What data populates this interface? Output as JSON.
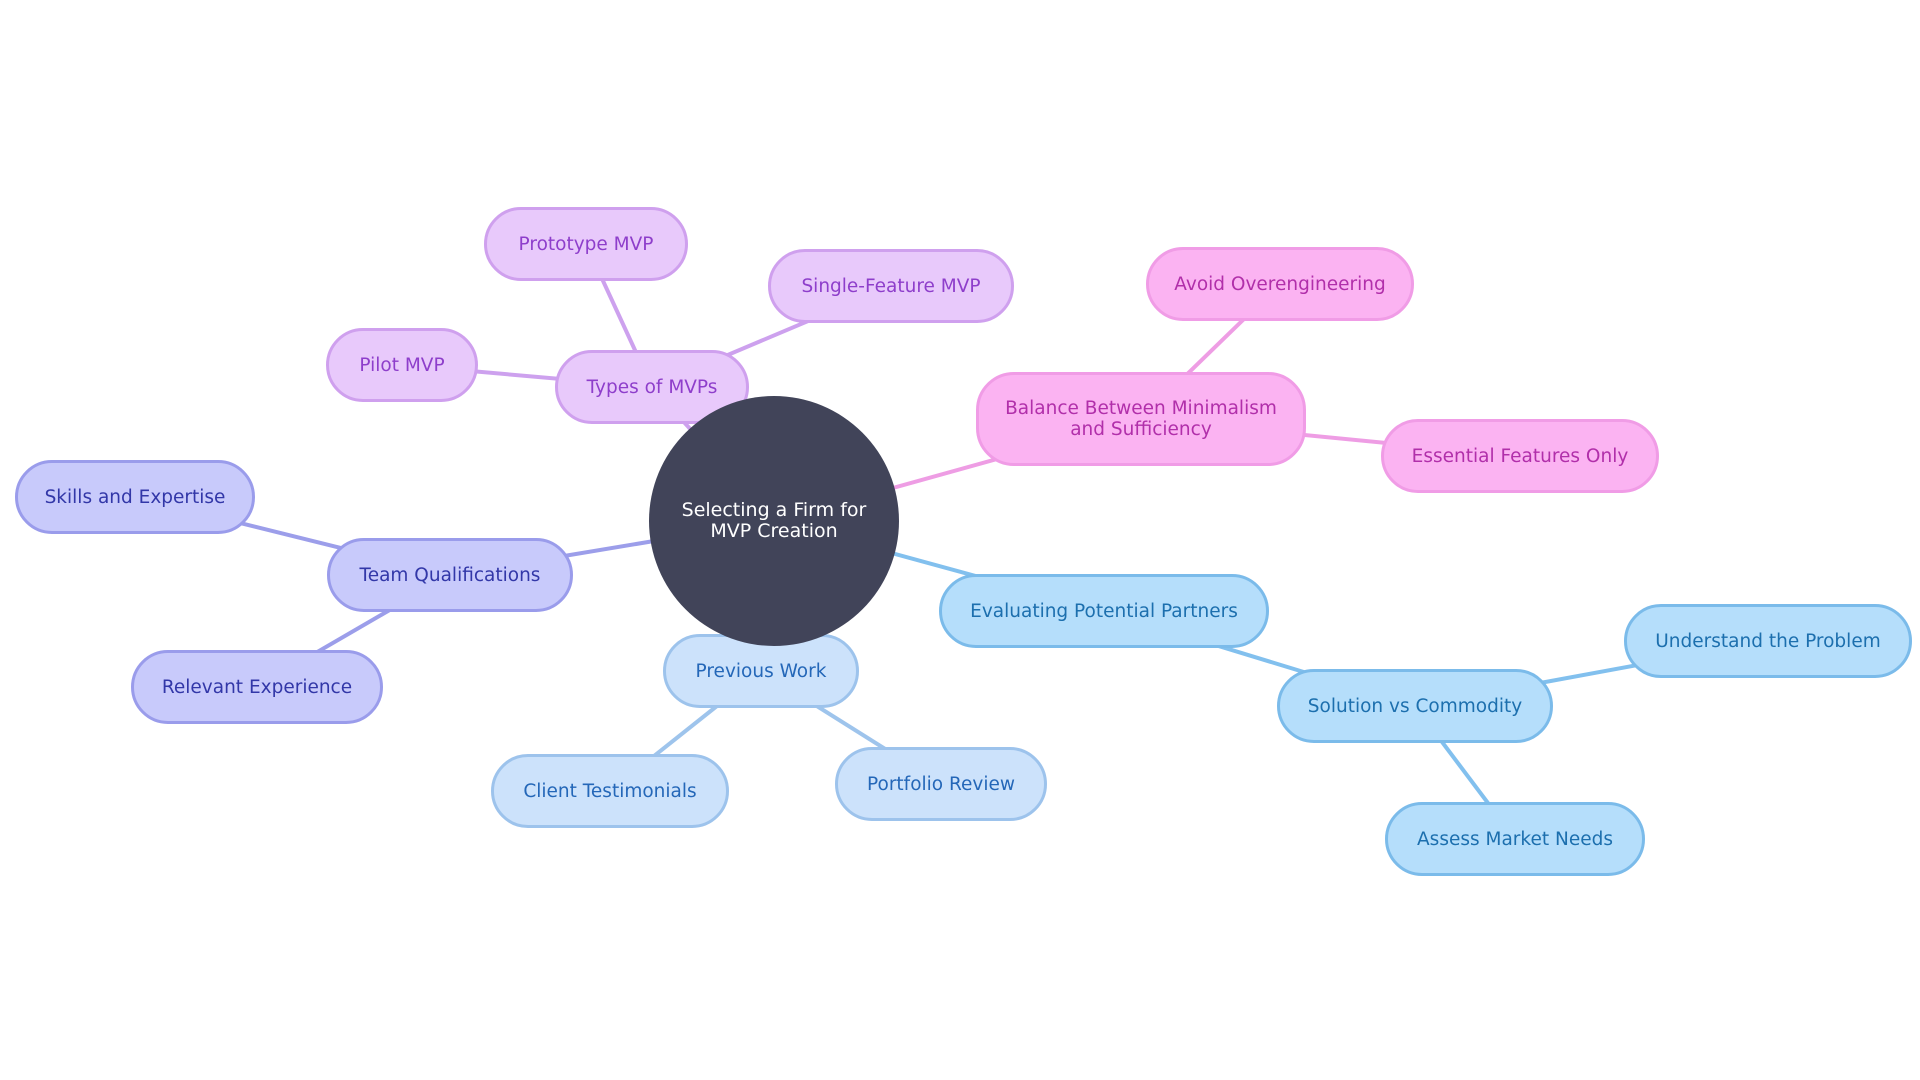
{
  "title": "Selecting a Firm for MVP Creation",
  "theme": {
    "root_fill": "#414459",
    "root_text": "#ffffff",
    "branches": {
      "purple": {
        "fill": "#E8C9FB",
        "border": "#CFA0EE",
        "text": "#8E3ECB",
        "line": "#CDA1EE"
      },
      "pink": {
        "fill": "#FBB3F2",
        "border": "#F09CE6",
        "text": "#B12FAA",
        "line": "#EE9DE4"
      },
      "cyan": {
        "fill": "#B5DEFB",
        "border": "#7BBBEA",
        "text": "#1C6FAE",
        "line": "#82C0EE"
      },
      "lightblue": {
        "fill": "#CCE2FB",
        "border": "#9DC3EC",
        "text": "#2467B8",
        "line": "#9EC4EC"
      },
      "indigo": {
        "fill": "#C8CAFB",
        "border": "#9A9CEB",
        "text": "#3237A8",
        "line": "#9C9EEA"
      }
    }
  },
  "nodes": [
    {
      "id": "root",
      "label": "Selecting a Firm for MVP Creation",
      "branch": "root",
      "parent": null
    },
    {
      "id": "types",
      "label": "Types of MVPs",
      "branch": "purple",
      "parent": "root"
    },
    {
      "id": "prototype",
      "label": "Prototype MVP",
      "branch": "purple",
      "parent": "types"
    },
    {
      "id": "single",
      "label": "Single-Feature MVP",
      "branch": "purple",
      "parent": "types"
    },
    {
      "id": "pilot",
      "label": "Pilot MVP",
      "branch": "purple",
      "parent": "types"
    },
    {
      "id": "balance",
      "label": "Balance Between Minimalism and Sufficiency",
      "branch": "pink",
      "parent": "root"
    },
    {
      "id": "avoid",
      "label": "Avoid Overengineering",
      "branch": "pink",
      "parent": "balance"
    },
    {
      "id": "essential",
      "label": "Essential Features Only",
      "branch": "pink",
      "parent": "balance"
    },
    {
      "id": "evaluating",
      "label": "Evaluating Potential Partners",
      "branch": "cyan",
      "parent": "root"
    },
    {
      "id": "solution",
      "label": "Solution vs Commodity",
      "branch": "cyan",
      "parent": "evaluating"
    },
    {
      "id": "understand",
      "label": "Understand the Problem",
      "branch": "cyan",
      "parent": "solution"
    },
    {
      "id": "assess",
      "label": "Assess Market Needs",
      "branch": "cyan",
      "parent": "solution"
    },
    {
      "id": "previous",
      "label": "Previous Work",
      "branch": "lightblue",
      "parent": "root"
    },
    {
      "id": "client",
      "label": "Client Testimonials",
      "branch": "lightblue",
      "parent": "previous"
    },
    {
      "id": "portfolio",
      "label": "Portfolio Review",
      "branch": "lightblue",
      "parent": "previous"
    },
    {
      "id": "team",
      "label": "Team Qualifications",
      "branch": "indigo",
      "parent": "root"
    },
    {
      "id": "skills",
      "label": "Skills and Expertise",
      "branch": "indigo",
      "parent": "team"
    },
    {
      "id": "relevant",
      "label": "Relevant Experience",
      "branch": "indigo",
      "parent": "team"
    }
  ]
}
